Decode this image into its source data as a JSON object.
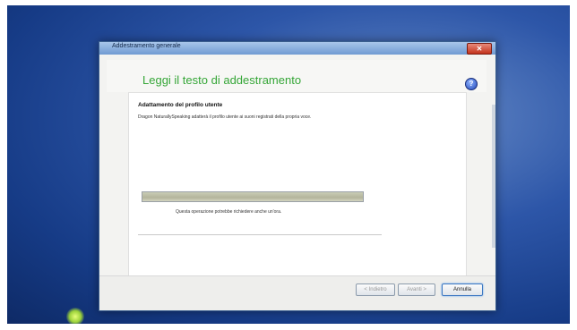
{
  "window": {
    "title": "Addestramento generale",
    "close_label": "✕"
  },
  "header": {
    "heading": "Leggi il testo di addestramento",
    "help_label": "?"
  },
  "content": {
    "section_title": "Adattamento del profilo utente",
    "description": "Dragon NaturallySpeaking adatterà il profilo utente ai suoni registrati della propria voce.",
    "progress": 1.0,
    "note": "Questa operazione potrebbe richiedere anche un'ora."
  },
  "footer": {
    "back_label": "< Indietro",
    "next_label": "Avanti >",
    "cancel_label": "Annulla"
  },
  "colors": {
    "heading": "#35a637",
    "desktop": "#2d56a8",
    "close_button": "#c3321c"
  },
  "icons": {
    "help": "help-icon",
    "close": "close-icon"
  }
}
